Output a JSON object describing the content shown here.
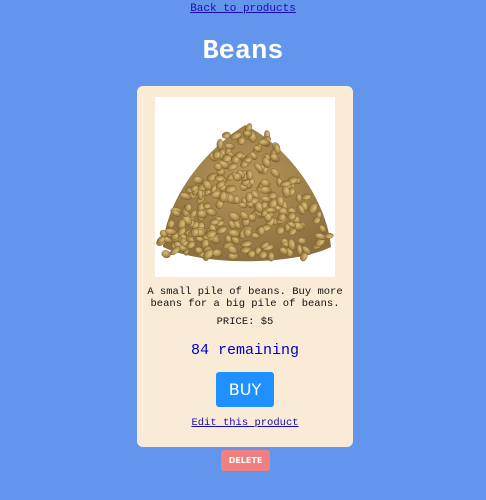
{
  "nav": {
    "back_label": "Back to products"
  },
  "product": {
    "title": "Beans",
    "image_alt": "lentils-pile-image",
    "description": "A small pile of beans. Buy more beans for a big pile of beans.",
    "price_label": "PRICE:",
    "price_value": "$5",
    "remaining_count": "84",
    "remaining_label": "remaining"
  },
  "actions": {
    "buy_label": "BUY",
    "edit_label": "Edit this product",
    "delete_label": "DELETE"
  },
  "colors": {
    "page_background": "#6495ed",
    "card_background": "#faebd7",
    "buy_button": "#1e90ff",
    "delete_button": "#f08080",
    "remaining_text": "#0000cd"
  }
}
